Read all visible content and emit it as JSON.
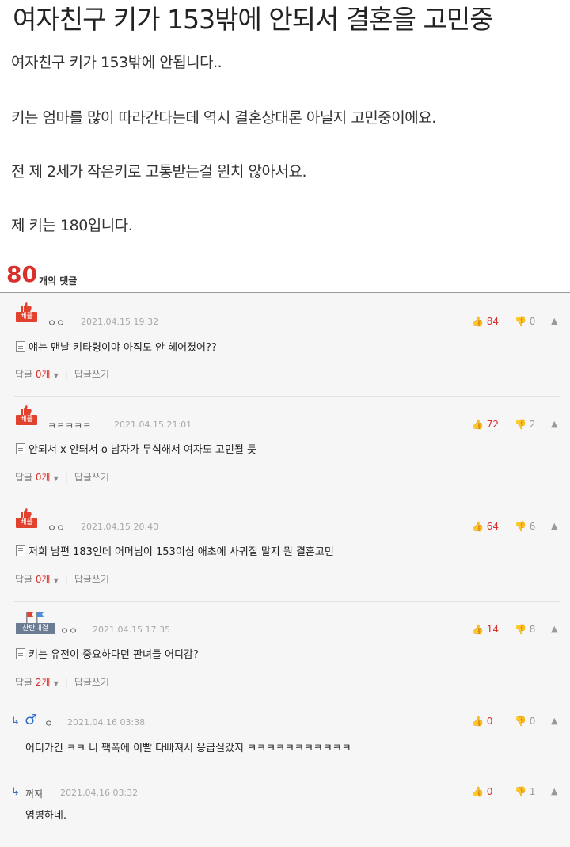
{
  "post": {
    "title": "여자친구 키가 153밖에 안되서 결혼을 고민중",
    "lines": [
      "여자친구 키가 153밖에 안됩니다..",
      "키는 엄마를 많이 따라간다는데 역시 결혼상대론 아닐지 고민중이에요.",
      "전 제 2세가 작은키로 고통받는걸 원치 않아서요.",
      "제 키는 180입니다."
    ]
  },
  "comment_count": {
    "number": "80",
    "label": "개의 댓글"
  },
  "comments": [
    {
      "badge": "베플",
      "badge_icon": "thumb-up-icon",
      "nick": "ㅇㅇ",
      "date": "2021.04.15 19:32",
      "text": "얘는 맨날 키타령이야 아직도 안 헤어졌어??",
      "likes": "84",
      "dislikes": "0",
      "reply_label": "답글",
      "reply_count": "0개",
      "write_reply": "답글쓰기"
    },
    {
      "badge": "베플",
      "badge_icon": "thumb-up-icon",
      "nick": "ㅋㅋㅋㅋㅋ",
      "date": "2021.04.15 21:01",
      "text": "안되서 x 안돼서 o 남자가 무식해서 여자도 고민될 듯",
      "likes": "72",
      "dislikes": "2",
      "reply_label": "답글",
      "reply_count": "0개",
      "write_reply": "답글쓰기"
    },
    {
      "badge": "베플",
      "badge_icon": "thumb-up-icon",
      "nick": "ㅇㅇ",
      "date": "2021.04.15 20:40",
      "text": "저희 남편 183인데 어머님이 153이심 애초에 사귀질 말지 뭔 결혼고민",
      "likes": "64",
      "dislikes": "6",
      "reply_label": "답글",
      "reply_count": "0개",
      "write_reply": "답글쓰기"
    },
    {
      "badge": "찬반대결",
      "badge_icon": "flag-icon",
      "nick": "ㅇㅇ",
      "date": "2021.04.15 17:35",
      "text": "키는 유전이 중요하다던 판녀들 어디감?",
      "likes": "14",
      "dislikes": "8",
      "reply_label": "답글",
      "reply_count": "2개",
      "write_reply": "답글쓰기"
    }
  ],
  "replies": [
    {
      "nick": "ㅇ",
      "date": "2021.04.16 03:38",
      "text": "어디가긴 ㅋㅋ 니 팩폭에 이빨 다빠져서 응급실갔지 ㅋㅋㅋㅋㅋㅋㅋㅋㅋㅋㅋ",
      "likes": "0",
      "dislikes": "0"
    },
    {
      "nick": "꺼져",
      "date": "2021.04.16 03:32",
      "text": "염병하네.",
      "likes": "0",
      "dislikes": "1"
    }
  ],
  "colors": {
    "accent": "#d9302c",
    "best_badge": "#e2412d",
    "chat_badge": "#6c7c93",
    "reply_arrow": "#3a6fb2"
  }
}
